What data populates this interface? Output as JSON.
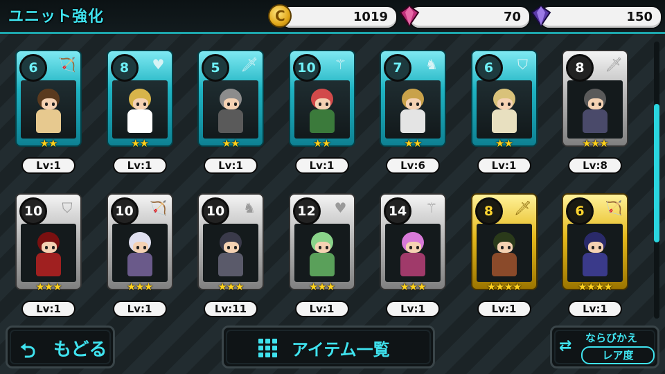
{
  "header": {
    "title": "ユニット強化",
    "gold": "1019",
    "gems_red": "70",
    "gems_purple": "150",
    "coin_symbol": "C"
  },
  "units": [
    {
      "cost": "6",
      "level": "Lv:1",
      "stars": 2,
      "frame": "teal",
      "class_icon": "bow-icon"
    },
    {
      "cost": "8",
      "level": "Lv:1",
      "stars": 2,
      "frame": "teal",
      "class_icon": "heart-icon"
    },
    {
      "cost": "5",
      "level": "Lv:1",
      "stars": 2,
      "frame": "teal",
      "class_icon": "sword-icon"
    },
    {
      "cost": "10",
      "level": "Lv:1",
      "stars": 2,
      "frame": "teal",
      "class_icon": "staff-icon"
    },
    {
      "cost": "7",
      "level": "Lv:6",
      "stars": 2,
      "frame": "teal",
      "class_icon": "horse-icon"
    },
    {
      "cost": "6",
      "level": "Lv:1",
      "stars": 2,
      "frame": "teal",
      "class_icon": "shield-icon"
    },
    {
      "cost": "8",
      "level": "Lv:8",
      "stars": 3,
      "frame": "silver",
      "class_icon": "sword-icon"
    },
    {
      "cost": "10",
      "level": "Lv:1",
      "stars": 3,
      "frame": "silver",
      "class_icon": "shield-icon"
    },
    {
      "cost": "10",
      "level": "Lv:1",
      "stars": 3,
      "frame": "silver",
      "class_icon": "bow-icon"
    },
    {
      "cost": "10",
      "level": "Lv:11",
      "stars": 3,
      "frame": "silver",
      "class_icon": "horse-icon"
    },
    {
      "cost": "12",
      "level": "Lv:1",
      "stars": 3,
      "frame": "silver",
      "class_icon": "heart-icon"
    },
    {
      "cost": "14",
      "level": "Lv:1",
      "stars": 3,
      "frame": "silver",
      "class_icon": "staff-icon"
    },
    {
      "cost": "8",
      "level": "Lv:1",
      "stars": 4,
      "frame": "gold",
      "class_icon": "sword-icon"
    },
    {
      "cost": "6",
      "level": "Lv:1",
      "stars": 4,
      "frame": "gold",
      "class_icon": "bow-icon"
    }
  ],
  "footer": {
    "back_label": "もどる",
    "items_label": "アイテム一覧",
    "sort_label": "ならびかえ",
    "sort_value": "レア度"
  },
  "colors": {
    "accent": "#3fe3ef",
    "star": "#ffd21e"
  }
}
